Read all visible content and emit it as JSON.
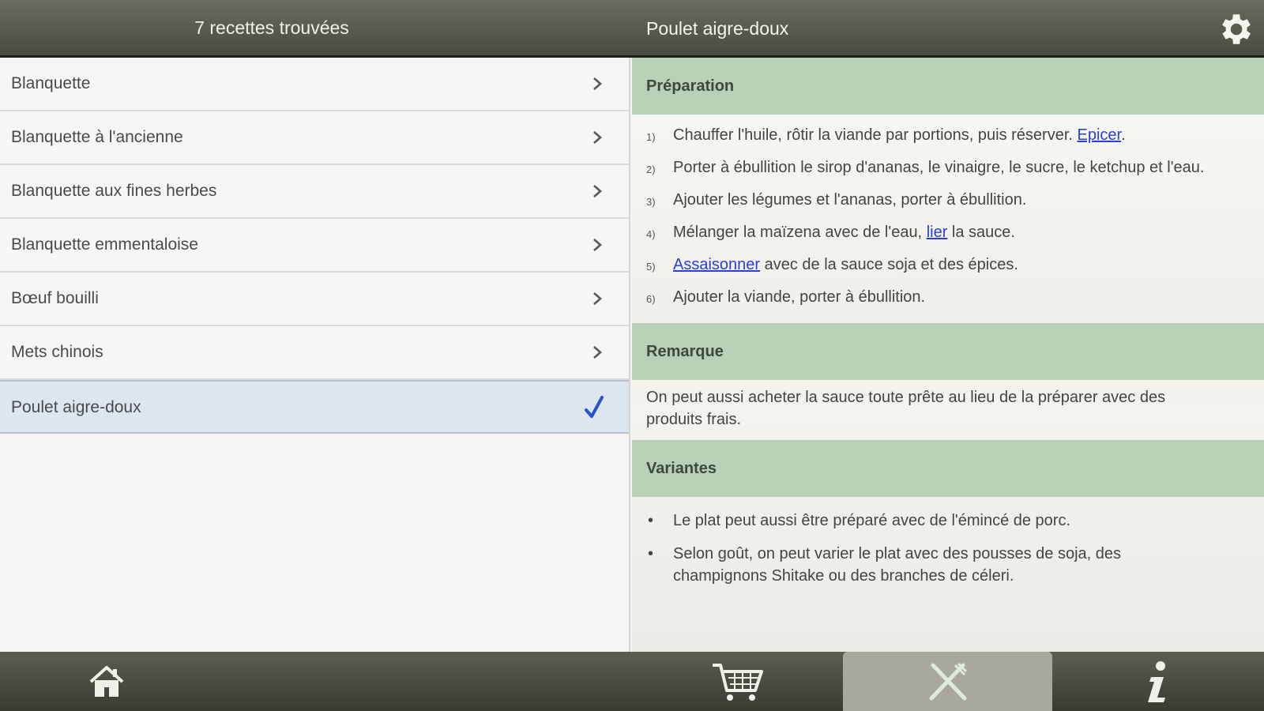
{
  "header": {
    "results_title": "7 recettes trouvées",
    "recipe_title": "Poulet aigre-doux"
  },
  "recipes": [
    {
      "label": "Blanquette"
    },
    {
      "label": "Blanquette à l'ancienne"
    },
    {
      "label": "Blanquette aux fines herbes"
    },
    {
      "label": "Blanquette emmentaloise"
    },
    {
      "label": "Bœuf bouilli"
    },
    {
      "label": "Mets chinois"
    },
    {
      "label": "Poulet aigre-doux"
    }
  ],
  "detail": {
    "preparation": {
      "heading": "Préparation",
      "steps": [
        {
          "num": "1)",
          "text_a": "Chauffer l'huile, rôtir la viande par portions, puis réserver. ",
          "link": "Epicer",
          "text_b": "."
        },
        {
          "num": "2)",
          "text_a": "Porter à ébullition le sirop d'ananas, le vinaigre, le sucre, le ketchup et l'eau."
        },
        {
          "num": "3)",
          "text_a": "Ajouter les légumes et l'ananas, porter à ébullition."
        },
        {
          "num": "4)",
          "text_a": "Mélanger la maïzena avec de l'eau, ",
          "link": "lier",
          "text_b": " la sauce."
        },
        {
          "num": "5)",
          "link": "Assaisonner",
          "text_b": " avec de la sauce soja et des épices."
        },
        {
          "num": "6)",
          "text_a": "Ajouter la viande, porter à ébullition."
        }
      ]
    },
    "remark": {
      "heading": "Remarque",
      "text": "On peut aussi acheter la sauce toute prête au lieu de la préparer avec des produits frais."
    },
    "variants": {
      "heading": "Variantes",
      "items": [
        "Le plat peut aussi être préparé avec de l'émincé de porc.",
        "Selon goût, on peut varier le plat avec des pousses de soja, des champignons Shitake ou des branches de céleri."
      ]
    }
  },
  "icons": {
    "settings": "gear-icon",
    "chevron": "chevron-right-icon",
    "check": "checkmark-icon",
    "home": "home-icon",
    "cart": "cart-icon",
    "recipe": "fork-knife-icon",
    "info": "info-icon"
  },
  "colors": {
    "section_header": "#b8d0b6",
    "selected_row": "#dde6ee",
    "link": "#2b3fd9",
    "check": "#2255cc"
  }
}
